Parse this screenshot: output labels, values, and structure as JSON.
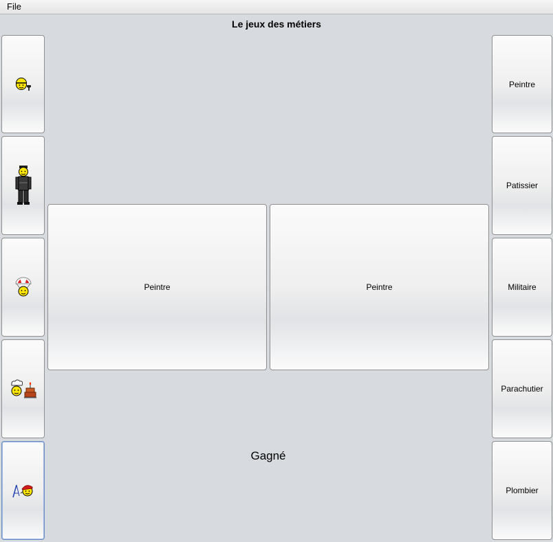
{
  "menubar": {
    "file_label": "File"
  },
  "game": {
    "title": "Le jeux des métiers",
    "status": "Gagné"
  },
  "left_buttons": [
    {
      "icon": "plumber-icon"
    },
    {
      "icon": "soldier-icon"
    },
    {
      "icon": "parachutist-icon"
    },
    {
      "icon": "pastry-chef-icon"
    },
    {
      "icon": "painter-icon"
    }
  ],
  "center_cards": [
    {
      "label": "Peintre"
    },
    {
      "label": "Peintre"
    }
  ],
  "right_buttons": [
    {
      "label": "Peintre"
    },
    {
      "label": "Patissier"
    },
    {
      "label": "Militaire"
    },
    {
      "label": "Parachutier"
    },
    {
      "label": "Plombier"
    }
  ],
  "colors": {
    "background": "#d7dadf",
    "smiley": "#ffe600",
    "focus_border": "#6b8fc4"
  }
}
